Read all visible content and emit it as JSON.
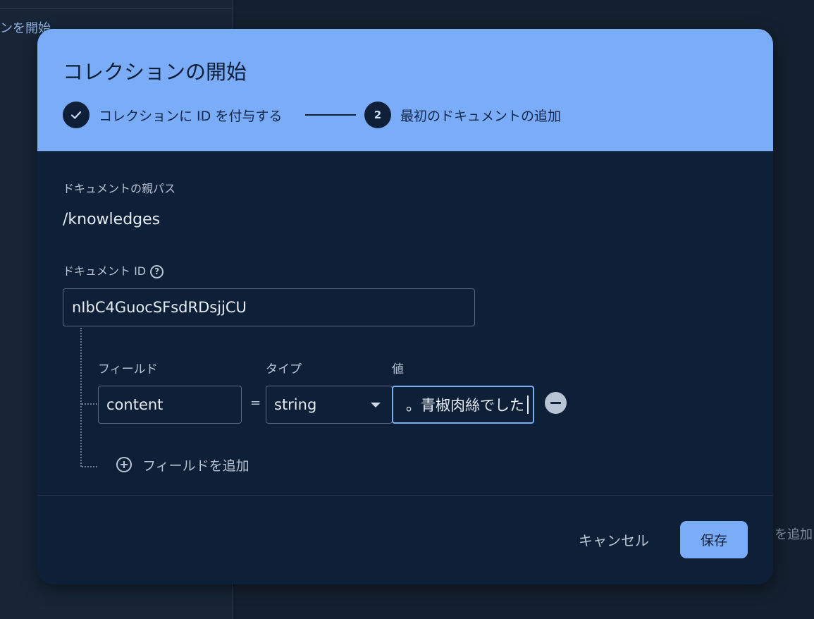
{
  "background": {
    "left_text": "ンを開始",
    "right_text": "を追加"
  },
  "dialog": {
    "title": "コレクションの開始",
    "steps": [
      {
        "marker": "✓",
        "label": "コレクションに ID を付与する",
        "status": "done"
      },
      {
        "marker": "2",
        "label": "最初のドキュメントの追加",
        "status": "active"
      }
    ],
    "parent_path_label": "ドキュメントの親パス",
    "parent_path_value": "/knowledges",
    "document_id_label": "ドキュメント ID",
    "document_id_value": "nIbC4GuocSFsdRDsjjCU",
    "columns": {
      "field": "フィールド",
      "type": "タイプ",
      "value": "値"
    },
    "field_row": {
      "name": "content",
      "equals": "=",
      "type": "string",
      "value": "青椒肉絲でした。"
    },
    "add_field_label": "フィールドを追加",
    "cancel_label": "キャンセル",
    "save_label": "保存"
  },
  "colors": {
    "header_bg": "#7aacf7",
    "dialog_bg": "#0e2037",
    "accent": "#7aacf7"
  }
}
